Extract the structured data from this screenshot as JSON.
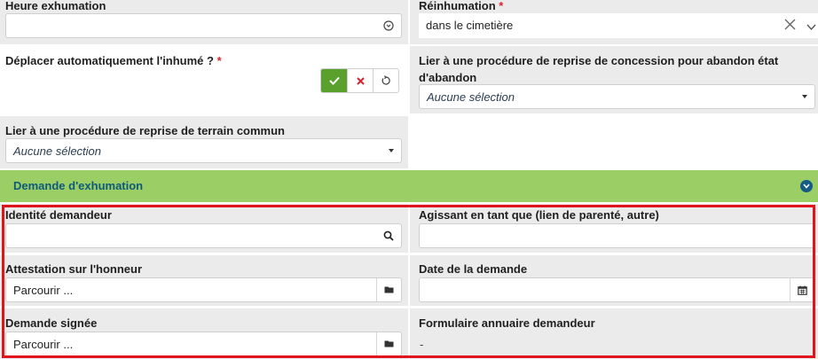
{
  "top": {
    "heure_exhumation": {
      "label": "Heure exhumation",
      "value": ""
    },
    "reinhumation": {
      "label": "Réinhumation",
      "required": "*",
      "value": "dans le cimetière"
    },
    "deplacer": {
      "label": "Déplacer automatiquement l'inhumé ?",
      "required": "*"
    },
    "lier_concession": {
      "label_line1": "Lier à une procédure de reprise de concession pour abandon état",
      "label_line2": "d'abandon",
      "value": "Aucune sélection"
    },
    "lier_terrain": {
      "label": "Lier à une procédure de reprise de terrain commun",
      "value": "Aucune sélection"
    }
  },
  "section": {
    "title": "Demande d'exhumation"
  },
  "demande": {
    "identite": {
      "label": "Identité demandeur",
      "value": ""
    },
    "agissant": {
      "label": "Agissant en tant que (lien de parenté, autre)",
      "value": ""
    },
    "attestation": {
      "label": "Attestation sur l'honneur",
      "value": "Parcourir ..."
    },
    "date_demande": {
      "label": "Date de la demande",
      "value": ""
    },
    "demande_signee": {
      "label": "Demande signée",
      "value": "Parcourir ..."
    },
    "formulaire": {
      "label": "Formulaire annuaire demandeur",
      "value": "-"
    }
  },
  "colors": {
    "section_bg": "#9bcf66",
    "section_text": "#0f5a7a",
    "check_bg": "#5aa02c",
    "cancel": "#d9232d",
    "highlight": "#e0141c"
  }
}
